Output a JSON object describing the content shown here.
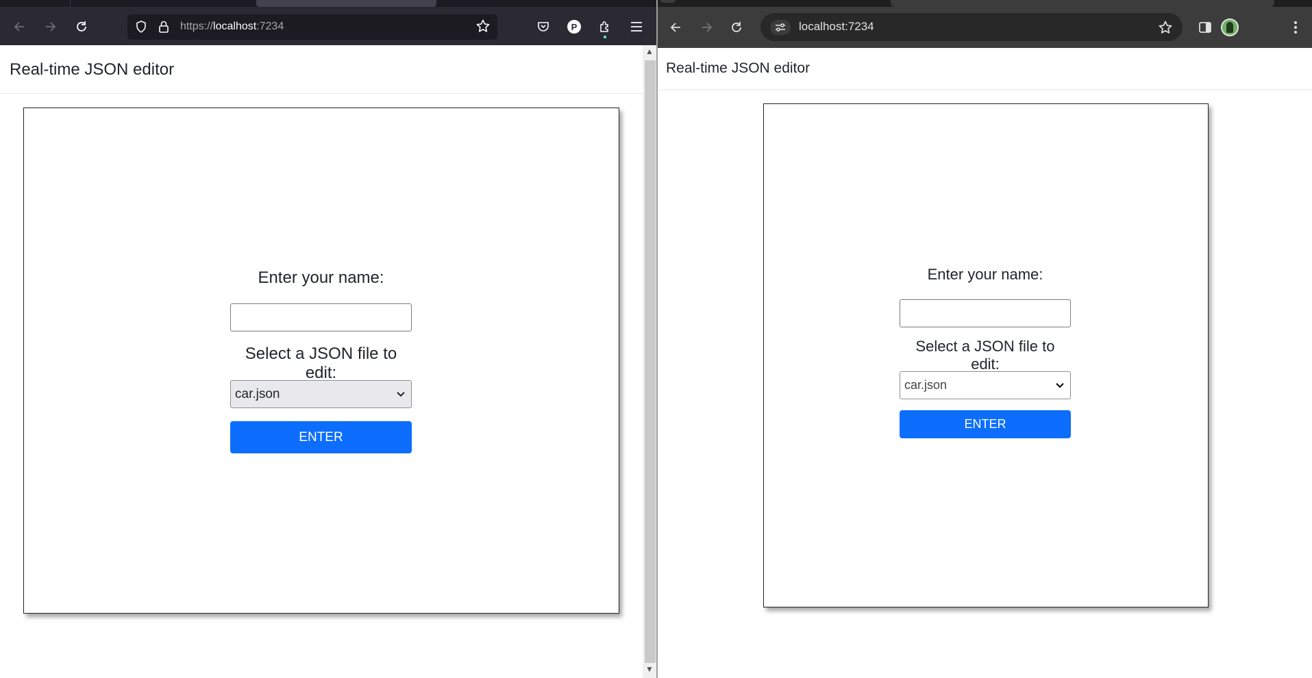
{
  "left_browser": {
    "url_scheme": "https://",
    "url_host": "localhost",
    "url_port": ":7234",
    "profile_initial": "P",
    "app": {
      "title": "Real-time JSON editor",
      "name_label": "Enter your name:",
      "name_value": "",
      "file_label": "Select a JSON file to edit:",
      "file_selected": "car.json",
      "enter_label": "ENTER"
    }
  },
  "right_browser": {
    "url": "localhost:7234",
    "app": {
      "title": "Real-time JSON editor",
      "name_label": "Enter your name:",
      "name_value": "",
      "file_label": "Select a JSON file to edit:",
      "file_selected": "car.json",
      "enter_label": "ENTER"
    }
  },
  "colors": {
    "firefox_toolbar": "#2b2a33",
    "chrome_toolbar": "#3c3c3c",
    "primary_button": "#0d6efd"
  },
  "icons": [
    "back-icon",
    "forward-icon",
    "reload-icon",
    "shield-icon",
    "lock-icon",
    "star-icon",
    "pocket-icon",
    "extensions-icon",
    "menu-icon",
    "site-settings-icon",
    "side-panel-icon",
    "kebab-menu-icon",
    "chevron-down-icon"
  ]
}
